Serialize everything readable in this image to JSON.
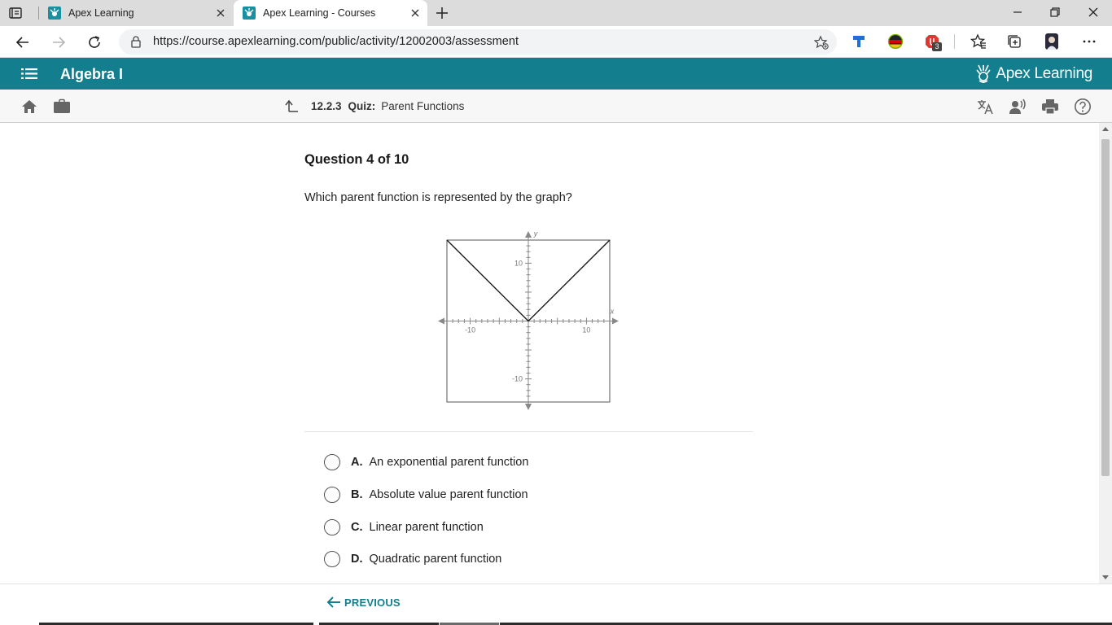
{
  "browser": {
    "tabs": [
      {
        "title": "Apex Learning",
        "active": false
      },
      {
        "title": "Apex Learning - Courses",
        "active": true
      }
    ],
    "url": "https://course.apexlearning.com/public/activity/12002003/assessment",
    "extension_badge": "3"
  },
  "app": {
    "course": "Algebra I",
    "brand": "Apex Learning",
    "accent_color": "#137f8e"
  },
  "toolbar": {
    "activity_number": "12.2.3",
    "activity_kind": "Quiz:",
    "activity_name": "Parent Functions",
    "icons": [
      "home-icon",
      "briefcase-icon",
      "translate-icon",
      "read-aloud-icon",
      "print-icon",
      "help-icon"
    ]
  },
  "question": {
    "counter": "Question 4 of 10",
    "prompt": "Which parent function is represented by the graph?",
    "graph": {
      "x_axis_label": "x",
      "y_axis_label": "y",
      "x_tick_labels": [
        "-10",
        "10"
      ],
      "y_tick_labels": [
        "10",
        "-10"
      ],
      "x_range": [
        -14,
        14
      ],
      "y_range": [
        -14,
        14
      ],
      "function": "y = |x|"
    },
    "choices": [
      {
        "letter": "A.",
        "text": "An exponential parent function"
      },
      {
        "letter": "B.",
        "text": "Absolute value parent function"
      },
      {
        "letter": "C.",
        "text": "Linear parent function"
      },
      {
        "letter": "D.",
        "text": "Quadratic parent function"
      }
    ]
  },
  "footer": {
    "previous_label": "PREVIOUS"
  }
}
